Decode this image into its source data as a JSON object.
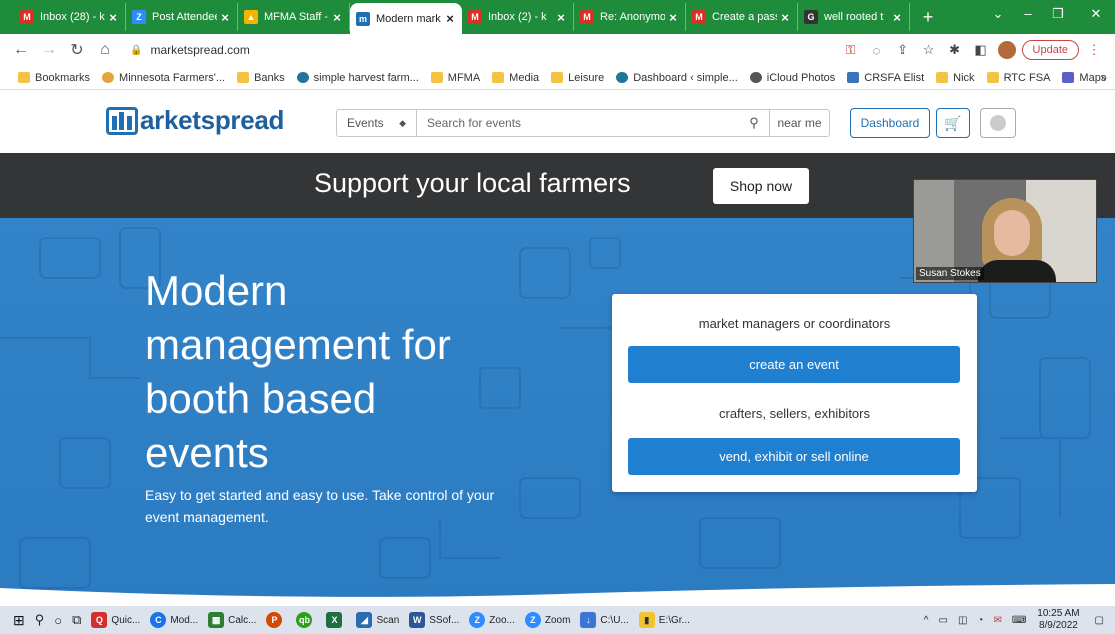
{
  "browser": {
    "tabs": [
      {
        "label": "Inbox (28) - k",
        "icon": "gmail-icon",
        "color": "#d93025",
        "glyph": "M"
      },
      {
        "label": "Post Attendee",
        "icon": "zoom-icon",
        "color": "#2d8cff",
        "glyph": "Z"
      },
      {
        "label": "MFMA Staff -",
        "icon": "drive-icon",
        "color": "#f4b400",
        "glyph": "▲"
      },
      {
        "label": "Modern mark",
        "icon": "marketspread-icon",
        "color": "#1f6fb5",
        "glyph": "m"
      },
      {
        "label": "Inbox (2) - k",
        "icon": "gmail-icon",
        "color": "#d93025",
        "glyph": "M"
      },
      {
        "label": "Re: Anonymo",
        "icon": "gmail-icon",
        "color": "#d93025",
        "glyph": "M"
      },
      {
        "label": "Create a pass",
        "icon": "gmail-icon",
        "color": "#d93025",
        "glyph": "M"
      },
      {
        "label": "well rooted t",
        "icon": "google-icon",
        "color": "#333333",
        "glyph": "G"
      }
    ],
    "url": "marketspread.com",
    "update_label": "Update",
    "bookmarks": [
      {
        "label": "Bookmarks",
        "icon": "folder-icon"
      },
      {
        "label": "Minnesota Farmers'...",
        "icon": "farm-icon"
      },
      {
        "label": "Banks",
        "icon": "folder-icon"
      },
      {
        "label": "simple harvest farm...",
        "icon": "wordpress-icon"
      },
      {
        "label": "MFMA",
        "icon": "folder-icon"
      },
      {
        "label": "Media",
        "icon": "folder-icon"
      },
      {
        "label": "Leisure",
        "icon": "folder-icon"
      },
      {
        "label": "Dashboard ‹ simple...",
        "icon": "wordpress-icon"
      },
      {
        "label": "iCloud Photos",
        "icon": "apple-icon"
      },
      {
        "label": "CRSFA Elist",
        "icon": "group-icon"
      },
      {
        "label": "Nick",
        "icon": "folder-icon"
      },
      {
        "label": "RTC FSA",
        "icon": "folder-icon"
      },
      {
        "label": "Maps",
        "icon": "teams-icon"
      }
    ]
  },
  "site": {
    "logo_text": "arketspread",
    "search": {
      "category": "Events",
      "placeholder": "Search for events",
      "near_me": "near me"
    },
    "dashboard_label": "Dashboard",
    "banner": {
      "text": "Support your local farmers",
      "button": "Shop now"
    },
    "hero": {
      "heading_lines": [
        "Modern",
        "management for",
        "booth based",
        "events"
      ],
      "subtext": "Easy to get started and easy to use. Take control of your event management."
    },
    "cta": {
      "label1": "market managers or coordinators",
      "button1": "create an event",
      "label2": "crafters, sellers, exhibitors",
      "button2": "vend, exhibit or sell online"
    }
  },
  "video": {
    "name": "Susan Stokes"
  },
  "taskbar": {
    "items": [
      {
        "label": "Quic...",
        "color": "#d32f2f",
        "glyph": "Q"
      },
      {
        "label": "Mod...",
        "color": "#1a73e8",
        "glyph": "C"
      },
      {
        "label": "Calc...",
        "color": "#2e7d32",
        "glyph": "▦"
      },
      {
        "label": "",
        "color": "#d04a02",
        "glyph": "P"
      },
      {
        "label": "",
        "color": "#2ca01c",
        "glyph": "qb"
      },
      {
        "label": "",
        "color": "#1d6f42",
        "glyph": "X"
      },
      {
        "label": "Scan",
        "color": "#2b6cb0",
        "glyph": "◢"
      },
      {
        "label": "SSof...",
        "color": "#2b579a",
        "glyph": "W"
      },
      {
        "label": "Zoo...",
        "color": "#2d8cff",
        "glyph": "Z"
      },
      {
        "label": "Zoom",
        "color": "#2d8cff",
        "glyph": "Z"
      },
      {
        "label": "C:\\U...",
        "color": "#3a76d8",
        "glyph": "↓"
      },
      {
        "label": "E:\\Gr...",
        "color": "#f1c232",
        "glyph": "▮"
      }
    ],
    "time": "10:25 AM",
    "date": "8/9/2022"
  }
}
